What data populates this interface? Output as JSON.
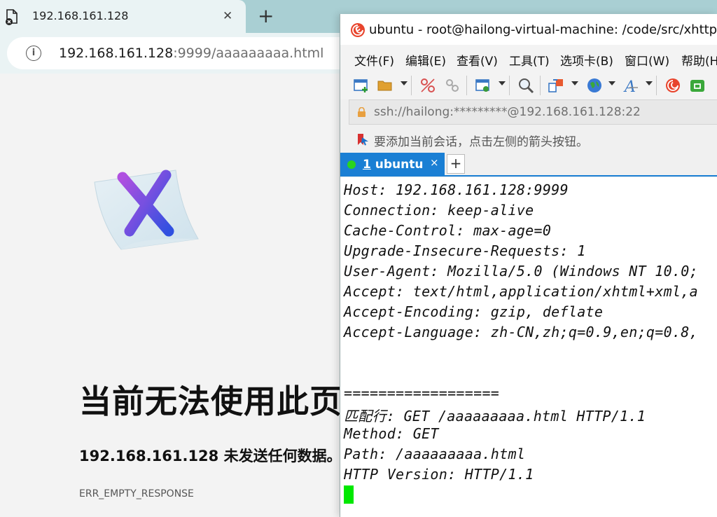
{
  "browser": {
    "tab_title": "192.168.161.128",
    "tab_close": "✕",
    "new_tab": "+",
    "url_host": "192.168.161.128",
    "url_rest": ":9999/aaaaaaaaa.html",
    "info_glyph": "i",
    "error_heading": "当前无法使用此页",
    "error_message": "192.168.161.128 未发送任何数据。",
    "error_code": "ERR_EMPTY_RESPONSE"
  },
  "xshell": {
    "title": "ubuntu - root@hailong-virtual-machine: /code/src/xhttp -",
    "menu": [
      "文件(F)",
      "编辑(E)",
      "查看(V)",
      "工具(T)",
      "选项卡(B)",
      "窗口(W)",
      "帮助(H"
    ],
    "address": "ssh://hailong:*********@192.168.161.128:22",
    "hint": "要添加当前会话，点击左侧的箭头按钮。",
    "tab": {
      "number": "1",
      "label": "ubuntu",
      "close": "×"
    },
    "new_tab": "+",
    "status_color": "#2ad41e",
    "accent_color": "#1a7fd4",
    "terminal_lines": [
      "Host: 192.168.161.128:9999",
      "Connection: keep-alive",
      "Cache-Control: max-age=0",
      "Upgrade-Insecure-Requests: 1",
      "User-Agent: Mozilla/5.0 (Windows NT 10.0;",
      "Accept: text/html,application/xhtml+xml,a",
      "Accept-Encoding: gzip, deflate",
      "Accept-Language: zh-CN,zh;q=0.9,en;q=0.8,",
      "",
      "",
      "==================",
      "匹配行: GET /aaaaaaaaa.html HTTP/1.1",
      "Method: GET",
      "Path: /aaaaaaaaa.html",
      "HTTP Version: HTTP/1.1"
    ]
  }
}
